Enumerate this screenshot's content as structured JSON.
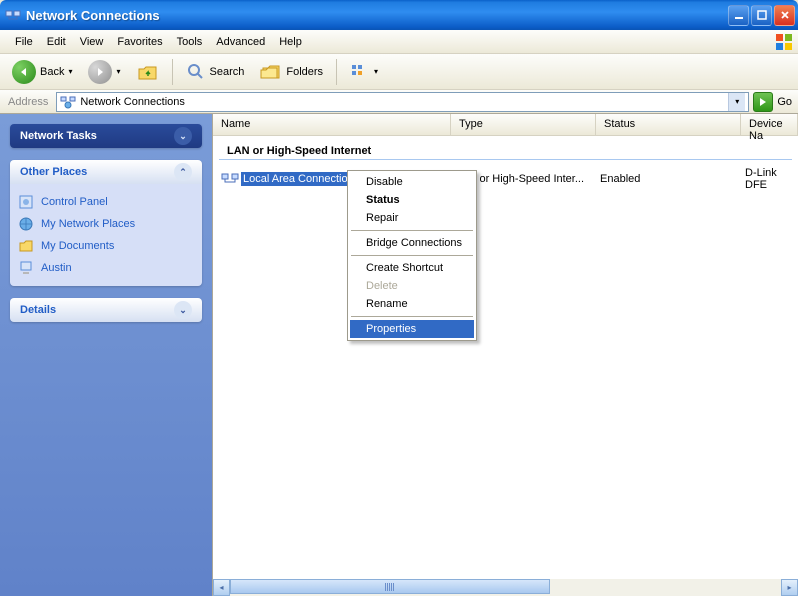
{
  "window": {
    "title": "Network Connections"
  },
  "menubar": [
    "File",
    "Edit",
    "View",
    "Favorites",
    "Tools",
    "Advanced",
    "Help"
  ],
  "toolbar": {
    "back_label": "Back",
    "search_label": "Search",
    "folders_label": "Folders"
  },
  "addressbar": {
    "label": "Address",
    "value": "Network Connections",
    "go_label": "Go"
  },
  "sidebar": {
    "panels": [
      {
        "title": "Network Tasks",
        "type": "dark",
        "collapsed": true
      },
      {
        "title": "Other Places",
        "type": "light",
        "links": [
          {
            "icon": "control-panel-icon",
            "label": "Control Panel"
          },
          {
            "icon": "network-places-icon",
            "label": "My Network Places"
          },
          {
            "icon": "folder-icon",
            "label": "My Documents"
          },
          {
            "icon": "computer-icon",
            "label": "Austin"
          }
        ]
      },
      {
        "title": "Details",
        "type": "light",
        "collapsed": true
      }
    ]
  },
  "listview": {
    "columns": [
      "Name",
      "Type",
      "Status",
      "Device Na"
    ],
    "group_title": "LAN or High-Speed Internet",
    "rows": [
      {
        "name": "Local Area Connection",
        "type": "LAN or High-Speed Inter...",
        "status": "Enabled",
        "device": "D-Link DFE"
      }
    ]
  },
  "context_menu": {
    "items": [
      {
        "label": "Disable"
      },
      {
        "label": "Status",
        "bold": true
      },
      {
        "label": "Repair"
      },
      {
        "sep": true
      },
      {
        "label": "Bridge Connections"
      },
      {
        "sep": true
      },
      {
        "label": "Create Shortcut"
      },
      {
        "label": "Delete",
        "disabled": true
      },
      {
        "label": "Rename"
      },
      {
        "sep": true
      },
      {
        "label": "Properties",
        "highlight": true
      }
    ]
  }
}
